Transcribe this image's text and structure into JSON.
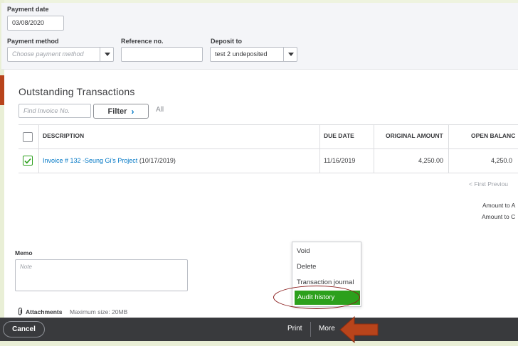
{
  "payment": {
    "date_label": "Payment date",
    "date_value": "03/08/2020",
    "method_label": "Payment method",
    "method_placeholder": "Choose payment method",
    "reference_label": "Reference no.",
    "reference_value": "",
    "deposit_label": "Deposit to",
    "deposit_value": "test 2 undeposited"
  },
  "outstanding": {
    "title": "Outstanding Transactions",
    "find_placeholder": "Find Invoice No.",
    "filter_label": "Filter",
    "all_label": "All",
    "columns": [
      "DESCRIPTION",
      "DUE DATE",
      "ORIGINAL AMOUNT",
      "OPEN BALANC"
    ],
    "rows": [
      {
        "checked": true,
        "description_link": "Invoice # 132 -Seung Gi's Project",
        "description_date": "(10/17/2019)",
        "due_date": "11/16/2019",
        "original_amount": "4,250.00",
        "open_balance": "4,250.0"
      }
    ],
    "pager_text": "< First   Previou",
    "amount_to_apply": "Amount to A",
    "amount_to_credit": "Amount to C"
  },
  "memo": {
    "label": "Memo",
    "placeholder": "Note"
  },
  "attachments": {
    "label": "Attachments",
    "max_size": "Maximum size: 20MB"
  },
  "more_menu": {
    "items": [
      "Void",
      "Delete",
      "Transaction journal",
      "Audit history"
    ]
  },
  "footer": {
    "cancel_label": "Cancel",
    "print_label": "Print",
    "more_label": "More"
  },
  "colors": {
    "accent_green": "#2ca01c",
    "link_blue": "#0077c5",
    "footer_bg": "#393a3d",
    "annotation_red": "#b8441b"
  }
}
